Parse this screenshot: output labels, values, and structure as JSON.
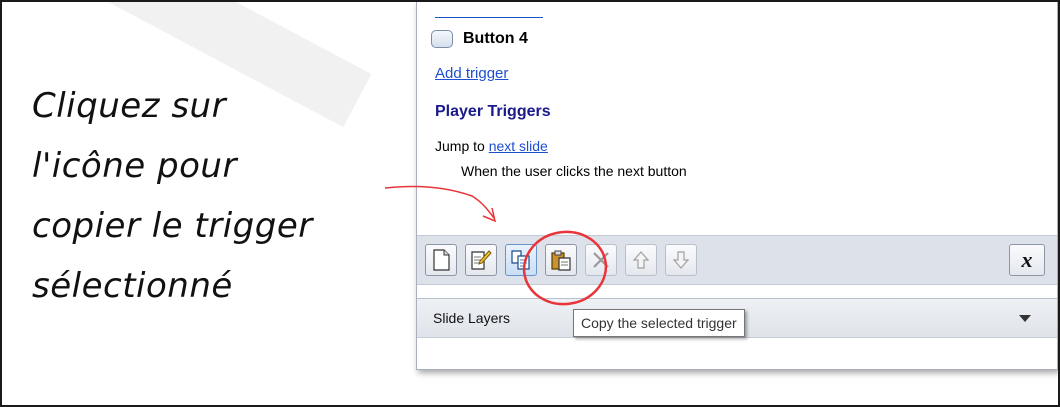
{
  "instruction": {
    "lines": [
      "Cliquez sur",
      "l'icône pour",
      "copier le trigger",
      "sélectionné"
    ]
  },
  "panel": {
    "button_item": "Button 4",
    "add_trigger_link": "Add trigger",
    "section_heading": "Player Triggers",
    "trigger": {
      "action_prefix": "Jump to",
      "target_link": "next slide",
      "condition": "When the user clicks the next button"
    },
    "toolbar": {
      "buttons": [
        {
          "icon": "new-trigger-icon",
          "state": "enabled"
        },
        {
          "icon": "edit-trigger-icon",
          "state": "enabled"
        },
        {
          "icon": "copy-trigger-icon",
          "state": "hover"
        },
        {
          "icon": "paste-trigger-icon",
          "state": "enabled"
        },
        {
          "icon": "delete-icon",
          "state": "disabled"
        },
        {
          "icon": "move-up-icon",
          "state": "disabled"
        },
        {
          "icon": "move-down-icon",
          "state": "disabled"
        }
      ],
      "variables_label": "x"
    },
    "layers_label": "Slide Layers",
    "tooltip": "Copy the selected trigger"
  },
  "colors": {
    "annotation_red": "#e8343a",
    "link_blue": "#1f4fd0",
    "heading_navy": "#1a1a8c",
    "toolbar_bg": "#dde2ea"
  }
}
